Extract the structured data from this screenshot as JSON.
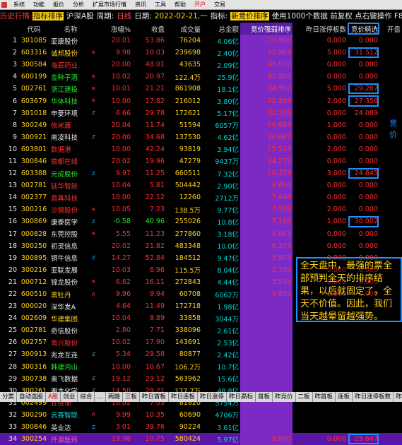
{
  "menu": [
    {
      "label": "系统"
    },
    {
      "label": "功能"
    },
    {
      "label": "报价"
    },
    {
      "label": "分析"
    },
    {
      "label": "扩展市场行情"
    },
    {
      "label": "资讯"
    },
    {
      "label": "工具"
    },
    {
      "label": "帮助"
    },
    {
      "label": "开户",
      "highlight": true
    },
    {
      "label": "交易"
    }
  ],
  "titlebar": {
    "prefix": "历史行情",
    "title": "指标排序",
    "market": "沪深A股",
    "period_label": "周期:",
    "period_value": "日线",
    "date_label": "日期:",
    "date_value": "2022-02-21,一",
    "indicator_label": "指标:",
    "indicator_value": "新竞价排序",
    "info": "使用1000个数据 前复权 点右键操作 F8"
  },
  "columns": [
    "",
    "代码",
    "名称",
    "",
    "涨幅%",
    "收盘",
    "成交量",
    "总金额",
    "竞价强弱排序",
    "昨日涨停板数",
    "竞价精选",
    "开盘"
  ],
  "rows": [
    {
      "seq": "1",
      "code": "301085",
      "name": "亚康股份",
      "name_color": "white",
      "tag": "",
      "pct": "20.01",
      "price": "53.86",
      "vol": "76204",
      "amt": "4.06亿",
      "comp": "79.906",
      "limit": "0.000",
      "best": "0.000",
      "boxed": false
    },
    {
      "seq": "2",
      "code": "603316",
      "name": "诚邦股份",
      "name_color": "yel",
      "tag": "R",
      "pct": "9.98",
      "price": "10.03",
      "vol": "239698",
      "amt": "2.40亿",
      "comp": "52.964",
      "limit": "5.000",
      "best": "31.512",
      "boxed": true
    },
    {
      "seq": "3",
      "code": "300584",
      "name": "海辰药业",
      "name_color": "red",
      "tag": "",
      "pct": "20.00",
      "price": "48.01",
      "vol": "43635",
      "amt": "2.09亿",
      "comp": "45.037",
      "limit": "0.000",
      "best": "0.000",
      "boxed": false
    },
    {
      "seq": "4",
      "code": "600199",
      "name": "金种子酒",
      "name_color": "grn",
      "tag": "R",
      "pct": "10.02",
      "price": "20.97",
      "vol": "122.4万",
      "amt": "25.9亿",
      "comp": "41.005",
      "limit": "0.000",
      "best": "0.000",
      "boxed": false
    },
    {
      "seq": "5",
      "code": "002761",
      "name": "浙江建投",
      "name_color": "grn",
      "tag": "R",
      "pct": "10.01",
      "price": "21.21",
      "vol": "861908",
      "amt": "18.1亿",
      "comp": "24.952",
      "limit": "5.000",
      "best": "29.267",
      "boxed": true
    },
    {
      "seq": "6",
      "code": "603679",
      "name": "华体科技",
      "name_color": "grn",
      "tag": "R",
      "pct": "10.00",
      "price": "17.82",
      "vol": "216012",
      "amt": "3.80亿",
      "comp": "21.339",
      "limit": "2.000",
      "best": "27.356",
      "boxed": true
    },
    {
      "seq": "7",
      "code": "301018",
      "name": "申菱环境",
      "name_color": "white",
      "tag": "Z",
      "pct": "6.66",
      "price": "29.78",
      "vol": "172621",
      "amt": "5.17亿",
      "comp": "20.226",
      "limit": "0.000",
      "best": "24.089",
      "boxed": false
    },
    {
      "seq": "8",
      "code": "300249",
      "name": "依米康",
      "name_color": "red",
      "tag": "",
      "pct": "20.04",
      "price": "11.74",
      "vol": "51594",
      "amt": "6057万",
      "comp": "16.697",
      "limit": "1.000",
      "best": "0.000",
      "boxed": false
    },
    {
      "seq": "9",
      "code": "300921",
      "name": "南凌科技",
      "name_color": "white",
      "tag": "Z",
      "pct": "20.00",
      "price": "34.68",
      "vol": "137530",
      "amt": "4.62亿",
      "comp": "16.087",
      "limit": "0.000",
      "best": "0.000",
      "boxed": false
    },
    {
      "seq": "10",
      "code": "603801",
      "name": "数据港",
      "name_color": "red",
      "tag": "",
      "pct": "10.00",
      "price": "42.24",
      "vol": "93819",
      "amt": "3.94亿",
      "comp": "15.527",
      "limit": "2.000",
      "best": "0.000",
      "boxed": false
    },
    {
      "seq": "11",
      "code": "300846",
      "name": "首都在线",
      "name_color": "red",
      "tag": "",
      "pct": "20.02",
      "price": "19.96",
      "vol": "47279",
      "amt": "9437万",
      "comp": "14.272",
      "limit": "0.000",
      "best": "0.000",
      "boxed": false
    },
    {
      "seq": "12",
      "code": "603388",
      "name": "元成股份",
      "name_color": "grn",
      "tag": "Z",
      "pct": "9.97",
      "price": "11.25",
      "vol": "660511",
      "amt": "7.32亿",
      "comp": "10.379",
      "limit": "3.000",
      "best": "24.645",
      "boxed": true
    },
    {
      "seq": "13",
      "code": "002781",
      "name": "延华智能",
      "name_color": "red",
      "tag": "",
      "pct": "10.04",
      "price": "5.81",
      "vol": "504442",
      "amt": "2.90亿",
      "comp": "8.854",
      "limit": "0.000",
      "best": "0.000",
      "boxed": false
    },
    {
      "seq": "14",
      "code": "002377",
      "name": "直真科技",
      "name_color": "red",
      "tag": "",
      "pct": "10.00",
      "price": "22.12",
      "vol": "12260",
      "amt": "2712万",
      "comp": "7.648",
      "limit": "0.000",
      "best": "0.000",
      "boxed": false
    },
    {
      "seq": "15",
      "code": "300216",
      "name": "沙钢股份",
      "name_color": "red",
      "tag": "R",
      "pct": "10.05",
      "price": "7.23",
      "vol": "138.5万",
      "amt": "9.77亿",
      "comp": "7.338",
      "limit": "2.000",
      "best": "0.000",
      "boxed": false
    },
    {
      "seq": "16",
      "code": "300869",
      "name": "康泰医学",
      "name_color": "white",
      "tag": "Z",
      "pct": "-0.58",
      "price": "40.96",
      "vol": "255026",
      "amt": "10.8亿",
      "comp": "7.160",
      "limit": "1.000",
      "best": "30.002",
      "boxed": true
    },
    {
      "seq": "17",
      "code": "000828",
      "name": "东莞控股",
      "name_color": "white",
      "tag": "R",
      "pct": "5.55",
      "price": "11.23",
      "vol": "277860",
      "amt": "3.18亿",
      "comp": "6.662",
      "limit": "0.000",
      "best": "0.000",
      "boxed": false
    },
    {
      "seq": "18",
      "code": "300250",
      "name": "初灵信息",
      "name_color": "white",
      "tag": "",
      "pct": "20.02",
      "price": "21.82",
      "vol": "483348",
      "amt": "10.0亿",
      "comp": "6.374",
      "limit": "0.000",
      "best": "0.000",
      "boxed": false
    },
    {
      "seq": "19",
      "code": "300895",
      "name": "铜牛信息",
      "name_color": "white",
      "tag": "Z",
      "pct": "14.27",
      "price": "52.84",
      "vol": "184512",
      "amt": "9.47亿",
      "comp": "5.955",
      "limit": "0.000",
      "best": "0.000",
      "boxed": false
    },
    {
      "seq": "20",
      "code": "300216",
      "name": "亚联发展",
      "name_color": "white",
      "tag": "",
      "pct": "10.03",
      "price": "6.96",
      "vol": "115.5万",
      "amt": "8.04亿",
      "comp": "5.736",
      "limit": "0.000",
      "best": "0.000",
      "boxed": false
    },
    {
      "seq": "21",
      "code": "000712",
      "name": "锦龙股份",
      "name_color": "white",
      "tag": "R",
      "pct": "6.62",
      "price": "16.11",
      "vol": "272843",
      "amt": "4.44亿",
      "comp": "5.594",
      "limit": "0.000",
      "best": "0.000",
      "boxed": false
    },
    {
      "seq": "22",
      "code": "600510",
      "name": "黑牡丹",
      "name_color": "yel",
      "tag": "R",
      "pct": "9.96",
      "price": "9.94",
      "vol": "60708",
      "amt": "6062万",
      "comp": "4.938",
      "limit": "0.000",
      "best": "0.000",
      "boxed": false
    },
    {
      "seq": "23",
      "code": "000020",
      "name": "深华发A",
      "name_color": "white",
      "tag": "",
      "pct": "4.64",
      "price": "11.49",
      "vol": "172718",
      "amt": "1.98亿",
      "comp": "",
      "limit": "",
      "best": "",
      "boxed": false
    },
    {
      "seq": "24",
      "code": "002609",
      "name": "华建集团",
      "name_color": "yel",
      "tag": "",
      "pct": "10.04",
      "price": "8.89",
      "vol": "33858",
      "amt": "3044万",
      "comp": "",
      "limit": "",
      "best": "",
      "boxed": false
    },
    {
      "seq": "25",
      "code": "002781",
      "name": "奇信股份",
      "name_color": "white",
      "tag": "",
      "pct": "2.80",
      "price": "7.71",
      "vol": "338096",
      "amt": "2.61亿",
      "comp": "",
      "limit": "",
      "best": "",
      "boxed": false
    },
    {
      "seq": "26",
      "code": "002757",
      "name": "南兴股份",
      "name_color": "red",
      "tag": "",
      "pct": "10.02",
      "price": "17.90",
      "vol": "143691",
      "amt": "2.53亿",
      "comp": "",
      "limit": "",
      "best": "",
      "boxed": false
    },
    {
      "seq": "27",
      "code": "300913",
      "name": "兆龙互连",
      "name_color": "white",
      "tag": "Z",
      "pct": "5.34",
      "price": "29.58",
      "vol": "80877",
      "amt": "2.42亿",
      "comp": "",
      "limit": "",
      "best": "",
      "boxed": false
    },
    {
      "seq": "28",
      "code": "300316",
      "name": "韩建河山",
      "name_color": "grn",
      "tag": "",
      "pct": "10.00",
      "price": "10.67",
      "vol": "106.2万",
      "amt": "10.7亿",
      "comp": "",
      "limit": "",
      "best": "",
      "boxed": false
    },
    {
      "seq": "29",
      "code": "300738",
      "name": "奥飞数据",
      "name_color": "white",
      "tag": "Z",
      "pct": "19.12",
      "price": "29.12",
      "vol": "563962",
      "amt": "15.6亿",
      "comp": "",
      "limit": "",
      "best": "",
      "boxed": false
    },
    {
      "seq": "30",
      "code": "300261",
      "name": "雅本化学",
      "name_color": "white",
      "tag": "Z",
      "pct": "14.50",
      "price": "29.21",
      "vol": "177.7万",
      "amt": "48.8亿",
      "comp": "",
      "limit": "",
      "best": "",
      "boxed": false
    },
    {
      "seq": "31",
      "code": "002499",
      "name": "甘咨询",
      "name_color": "red",
      "tag": "",
      "pct": "10.02",
      "price": "7.03",
      "vol": "81820",
      "amt": "5754万",
      "comp": "",
      "limit": "",
      "best": "",
      "boxed": false
    },
    {
      "seq": "32",
      "code": "300290",
      "name": "云赛智联",
      "name_color": "cy",
      "tag": "R",
      "pct": "9.99",
      "price": "10.35",
      "vol": "60690",
      "amt": "4706万",
      "comp": "",
      "limit": "",
      "best": "",
      "boxed": false
    },
    {
      "seq": "33",
      "code": "300846",
      "name": "英业达",
      "name_color": "white",
      "tag": "Z",
      "pct": "3.01",
      "price": "39.76",
      "vol": "90224",
      "amt": "3.61亿",
      "comp": "",
      "limit": "",
      "best": "",
      "boxed": false
    },
    {
      "seq": "34",
      "code": "300254",
      "name": "仟源医药",
      "name_color": "pink",
      "tag": "",
      "pct": "19.98",
      "price": "10.75",
      "vol": "580424",
      "amt": "5.97亿",
      "comp": "3.840",
      "limit": "0.000",
      "best": "25.647",
      "boxed": true
    }
  ],
  "annotation": "全天盘中，最强的票全部预判全天的排序结果，以后就固定了，全天不价值。因此，我们当天越晕留越强势。",
  "side_label": "竞价",
  "bottom_tabs": [
    "分类",
    "自动选股",
    "A股",
    "创业",
    "综合",
    "…",
    "两融",
    "三板",
    "昨日首板",
    "昨日连板",
    "昨日涨停",
    "昨日高标",
    "首板",
    "昨竞价",
    "二板",
    "昨首板",
    "连板",
    "昨日涨停板数",
    "昨首板"
  ],
  "colors": {
    "accent": "#1e90ff",
    "purple": "#7d2ac4",
    "red": "#ff3030",
    "yellow": "#ffd21a",
    "cyan": "#00d8d8",
    "green": "#22ee22"
  }
}
